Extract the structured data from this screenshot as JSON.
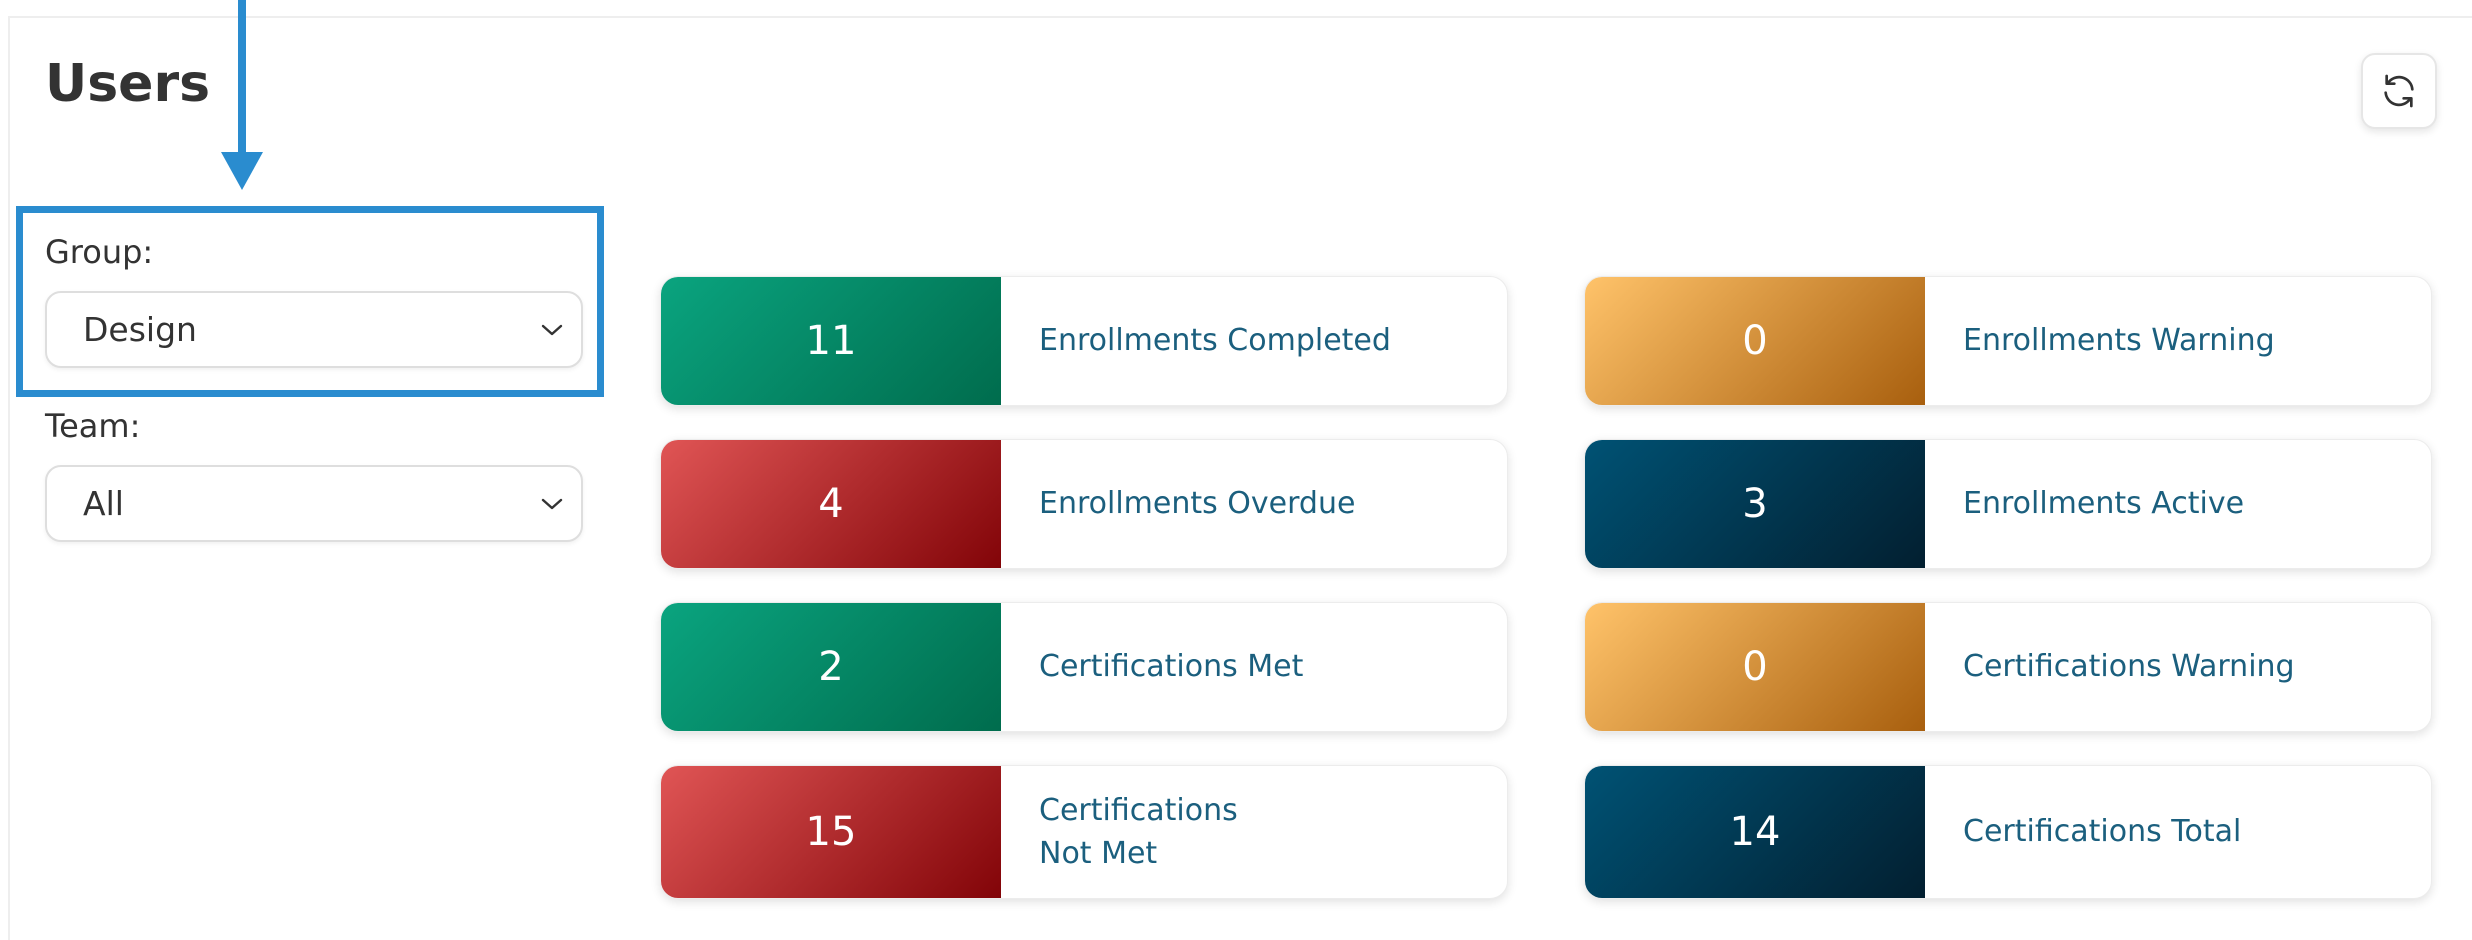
{
  "page": {
    "title": "Users"
  },
  "header": {
    "refresh_icon": "refresh-icon"
  },
  "annotation": {
    "color": "#2a8ccf"
  },
  "filters": {
    "group": {
      "label": "Group:",
      "value": "Design"
    },
    "team": {
      "label": "Team:",
      "value": "All"
    }
  },
  "stats": [
    {
      "count": "11",
      "label": "Enrollments Completed",
      "color": "green"
    },
    {
      "count": "0",
      "label": "Enrollments Warning",
      "color": "orange"
    },
    {
      "count": "4",
      "label": "Enrollments Overdue",
      "color": "red"
    },
    {
      "count": "3",
      "label": "Enrollments Active",
      "color": "navy"
    },
    {
      "count": "2",
      "label": "Certifications Met",
      "color": "green"
    },
    {
      "count": "0",
      "label": "Certifications Warning",
      "color": "orange"
    },
    {
      "count": "15",
      "label": "Certifications\nNot Met",
      "color": "red"
    },
    {
      "count": "14",
      "label": "Certifications Total",
      "color": "navy"
    }
  ],
  "colors": {
    "green": "#0aa47f",
    "red": "#e05555",
    "orange": "#ffc36a",
    "navy": "#005274",
    "label_text": "#1b5f7e"
  }
}
